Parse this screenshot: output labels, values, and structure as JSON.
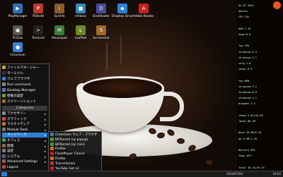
{
  "desktop_icons": [
    {
      "label": "PlayManager",
      "color": "#2d6fb8",
      "glyph": "▶"
    },
    {
      "label": "PDFedit",
      "color": "#b83a2d",
      "glyph": "P"
    },
    {
      "label": "SysInfo",
      "color": "#8a5a2d",
      "glyph": "i"
    },
    {
      "label": "Infobox",
      "color": "#2d8ab8",
      "glyph": "■"
    },
    {
      "label": "DiskReader",
      "color": "#4a4a9a",
      "glyph": "D"
    },
    {
      "label": "Dropbox Drive",
      "color": "#2d7fd8",
      "glyph": "◆"
    },
    {
      "label": "Adobe Reader",
      "color": "#c82020",
      "glyph": "A"
    },
    {
      "label": "PCDisk",
      "color": "#555555",
      "glyph": "▣"
    },
    {
      "label": "Terminal",
      "color": "#222222",
      "glyph": ">"
    },
    {
      "label": "Mousepad",
      "color": "#3a7a3a",
      "glyph": "M"
    },
    {
      "label": "LeafPad",
      "color": "#6a8a2a",
      "glyph": "L"
    },
    {
      "label": "Screenshot",
      "color": "#a06a2a",
      "glyph": "S"
    },
    {
      "label": "Chromium",
      "color": "#3a80d0",
      "glyph": "●"
    }
  ],
  "menu": {
    "items": [
      {
        "label": "ファイルマネージャー",
        "color": "#c8a040"
      },
      {
        "label": "ターミナル",
        "color": "#333333"
      },
      {
        "label": "ウェブブラウザ",
        "color": "#3a80d0"
      },
      {
        "label": "Run command",
        "color": "#888888"
      },
      {
        "label": "Desktop Manager",
        "color": "#5a7ab8"
      },
      {
        "label": "壁紙の設定",
        "color": "#6a9a4a"
      },
      {
        "label": "スクリーンショット",
        "color": "#a06a2a"
      }
    ],
    "categories_header": "Categories",
    "categories": [
      {
        "label": "アクセサリー",
        "color": "#888888"
      },
      {
        "label": "グラフィック",
        "color": "#c05050"
      },
      {
        "label": "マルチメディア",
        "color": "#c07030"
      },
      {
        "label": "Module Tools",
        "color": "#777777"
      },
      {
        "label": "ネットワーク",
        "color": "#3a80d0"
      },
      {
        "label": "オフィス",
        "color": "#4a9a4a"
      },
      {
        "label": "開発",
        "color": "#8a6a3a"
      },
      {
        "label": "設定",
        "color": "#7a7a7a"
      },
      {
        "label": "システム",
        "color": "#5a5a9a"
      },
      {
        "label": "Advanced Settings",
        "color": "#9a5a5a"
      }
    ],
    "logout": "Logout"
  },
  "submenu": [
    {
      "label": "Chromium ウェブ・ブラウザ",
      "color": "#3a80d0"
    },
    {
      "label": "BitTorrent (sy popup)",
      "color": "#3a9a3a"
    },
    {
      "label": "BitTorrent (sy mini)",
      "color": "#3a9a3a"
    },
    {
      "label": "Firefox",
      "color": "#e06a20"
    },
    {
      "label": "FlashPlayer Choice",
      "color": "#c02020"
    },
    {
      "label": "Firefox",
      "color": "#e06a20"
    },
    {
      "label": "Transmission",
      "color": "#c03030"
    },
    {
      "label": "YouTube Get x2",
      "color": "#d02020"
    }
  ],
  "conky": {
    "rows": [
      "04.07.2014",
      "Ubuntu",
      "CPU 14%",
      "",
      "RAM 1.1G",
      "Swap 0.0",
      "",
      "Top CPU",
      "chromium  4.3",
      "chromium  2.1",
      "xorg      1.8",
      "conky     0.9",
      "",
      "Top MEM",
      "chromium  9.2",
      "chromium  6.8",
      "chromium  4.1",
      "dropbox   3.3",
      "",
      "/home  5.6G/20.0G",
      "/boot  88.7M",
      "",
      "Down 20.0M/6.3G",
      "Up   0.5M/1.2G",
      "",
      "Battery 86%",
      "Temp 44°C",
      "",
      "Total 16.1G/29.5G"
    ]
  },
  "taskbar": {
    "clock": "18:02",
    "date": "2014/07/04"
  }
}
